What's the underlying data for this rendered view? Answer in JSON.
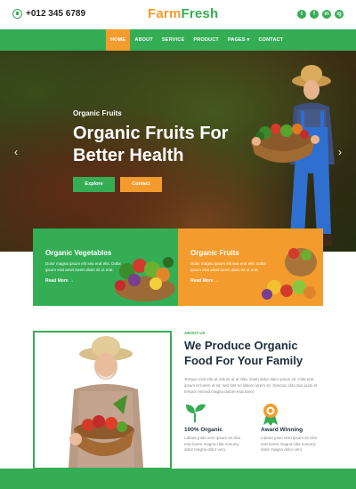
{
  "topbar": {
    "phone": "+012 345 6789",
    "logo_part1": "Farm",
    "logo_part2": "Fresh",
    "socials": [
      "t",
      "f",
      "in",
      "ig"
    ]
  },
  "nav": {
    "items": [
      "HOME",
      "ABOUT",
      "SERVICE",
      "PRODUCT",
      "PAGES ▾",
      "CONTACT"
    ],
    "active": "HOME"
  },
  "hero": {
    "subtitle": "Organic Fruits",
    "title": "Organic Fruits For Better Health",
    "explore_label": "Explore",
    "contact_label": "Contact",
    "prev_arrow": "‹",
    "next_arrow": "›"
  },
  "features": [
    {
      "title": "Organic Vegetables",
      "text": "Dolor magna ipsum elit sea erat elitr. Dolor ipsum erat amet lorem diam sit ut erat.",
      "link": "Read More →"
    },
    {
      "title": "Organic Fruits",
      "text": "Dolor magna ipsum elit sea erat elitr. Dolor ipsum erat amet lorem diam sit ut erat.",
      "link": "Read More →"
    }
  ],
  "about": {
    "label": "ABOUT US",
    "title": "We Produce Organic Food For Your Family",
    "text": "Tempor erat elitr at rebum at at clita. Diam dolor diam ipsum sit. Clita erat ipsum et lorem et sit, sed stet no labore lorem sit. Sanctus clita duo justo et tempor eirmod magna dolore erat amet",
    "stats": [
      {
        "title": "100% Organic",
        "text": "Labore justo vero ipsum sit clita erat lorem magna clita nonumy dolor magna dolor vero"
      },
      {
        "title": "Award Winning",
        "text": "Labore justo vero ipsum sit clita erat lorem magna clita nonumy dolor magna dolor vero"
      }
    ]
  },
  "colors": {
    "green": "#34ad54",
    "orange": "#f39c2d",
    "dark": "#1f2d3d"
  }
}
